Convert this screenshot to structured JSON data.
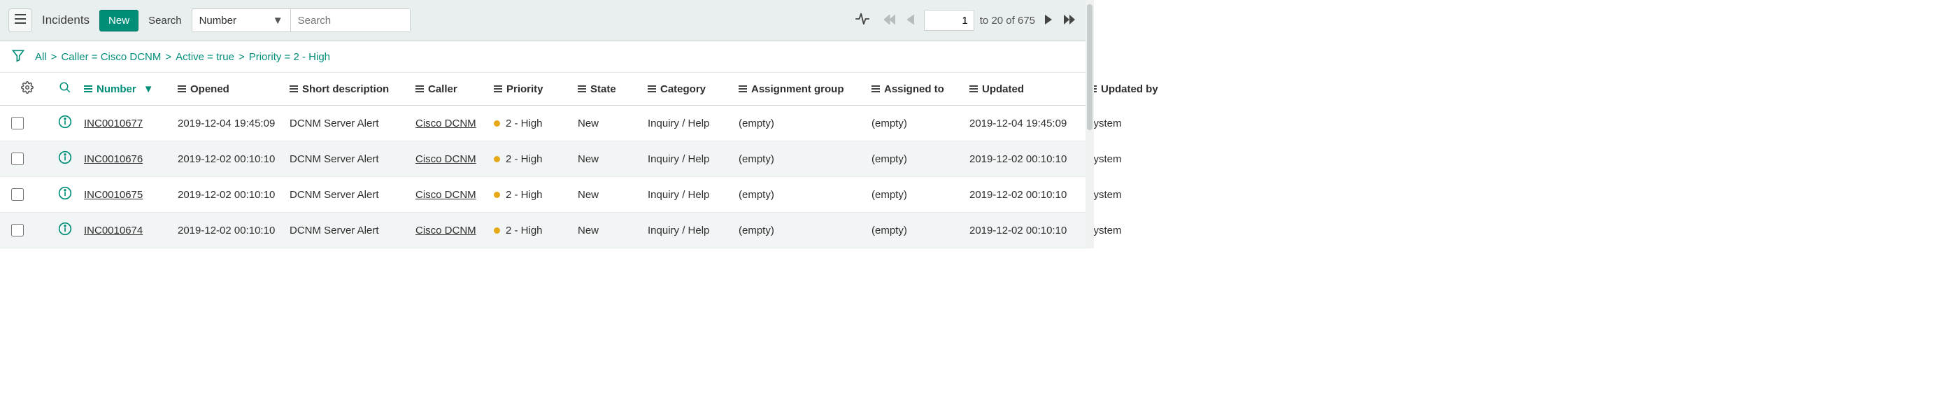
{
  "toolbar": {
    "title": "Incidents",
    "new_label": "New",
    "search_label": "Search",
    "search_field_selected": "Number",
    "search_placeholder": "Search"
  },
  "pager": {
    "current": "1",
    "range": "to 20 of 675"
  },
  "breadcrumbs": [
    "All",
    "Caller = Cisco DCNM",
    "Active = true",
    "Priority = 2 - High"
  ],
  "columns": [
    "Number",
    "Opened",
    "Short description",
    "Caller",
    "Priority",
    "State",
    "Category",
    "Assignment group",
    "Assigned to",
    "Updated",
    "Updated by"
  ],
  "sort_column": "Number",
  "rows": [
    {
      "number": "INC0010677",
      "opened": "2019-12-04 19:45:09",
      "short_description": "DCNM Server Alert",
      "caller": "Cisco DCNM",
      "priority": "2 - High",
      "priority_color": "#e6a817",
      "state": "New",
      "category": "Inquiry / Help",
      "assignment_group": "(empty)",
      "assigned_to": "(empty)",
      "updated": "2019-12-04 19:45:09",
      "updated_by": "system"
    },
    {
      "number": "INC0010676",
      "opened": "2019-12-02 00:10:10",
      "short_description": "DCNM Server Alert",
      "caller": "Cisco DCNM",
      "priority": "2 - High",
      "priority_color": "#e6a817",
      "state": "New",
      "category": "Inquiry / Help",
      "assignment_group": "(empty)",
      "assigned_to": "(empty)",
      "updated": "2019-12-02 00:10:10",
      "updated_by": "system"
    },
    {
      "number": "INC0010675",
      "opened": "2019-12-02 00:10:10",
      "short_description": "DCNM Server Alert",
      "caller": "Cisco DCNM",
      "priority": "2 - High",
      "priority_color": "#e6a817",
      "state": "New",
      "category": "Inquiry / Help",
      "assignment_group": "(empty)",
      "assigned_to": "(empty)",
      "updated": "2019-12-02 00:10:10",
      "updated_by": "system"
    },
    {
      "number": "INC0010674",
      "opened": "2019-12-02 00:10:10",
      "short_description": "DCNM Server Alert",
      "caller": "Cisco DCNM",
      "priority": "2 - High",
      "priority_color": "#e6a817",
      "state": "New",
      "category": "Inquiry / Help",
      "assignment_group": "(empty)",
      "assigned_to": "(empty)",
      "updated": "2019-12-02 00:10:10",
      "updated_by": "system"
    }
  ]
}
